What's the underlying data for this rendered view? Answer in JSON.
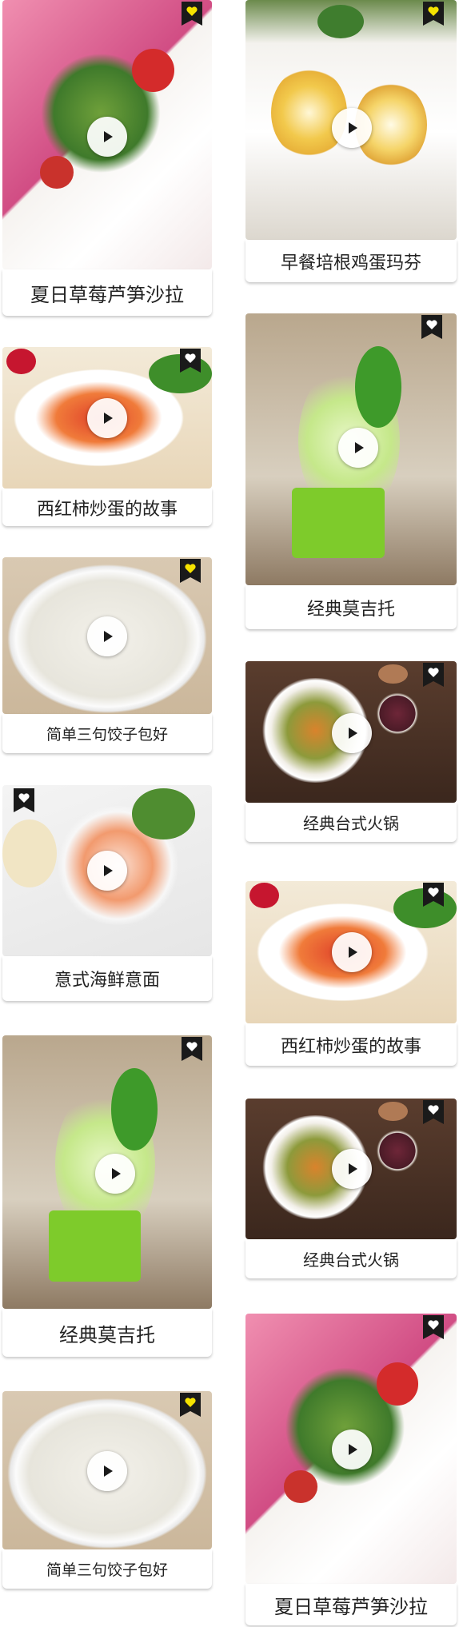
{
  "colors": {
    "badge_dark": "#1a1a1a",
    "heart_yellow": "#f5e200",
    "heart_white": "#ffffff",
    "title_text": "#222222"
  },
  "left_column": [
    {
      "title": "夏日草莓芦笋沙拉",
      "badge_icon": "heart-icon"
    },
    {
      "title": "西红柿炒蛋的故事",
      "badge_icon": "heart-icon"
    },
    {
      "title": "简单三句饺子包好",
      "badge_icon": "heart-icon"
    },
    {
      "title": "意式海鲜意面",
      "badge_icon": "heart-icon"
    },
    {
      "title": "经典莫吉托",
      "badge_icon": "heart-icon"
    },
    {
      "title": "简单三句饺子包好",
      "badge_icon": "heart-icon"
    }
  ],
  "right_column": [
    {
      "title": "早餐培根鸡蛋玛芬",
      "badge_icon": "heart-icon"
    },
    {
      "title": "经典莫吉托",
      "badge_icon": "heart-icon"
    },
    {
      "title": "经典台式火锅",
      "badge_icon": "heart-icon"
    },
    {
      "title": "西红柿炒蛋的故事",
      "badge_icon": "heart-icon"
    },
    {
      "title": "经典台式火锅",
      "badge_icon": "heart-icon"
    },
    {
      "title": "夏日草莓芦笋沙拉",
      "badge_icon": "heart-icon"
    }
  ]
}
